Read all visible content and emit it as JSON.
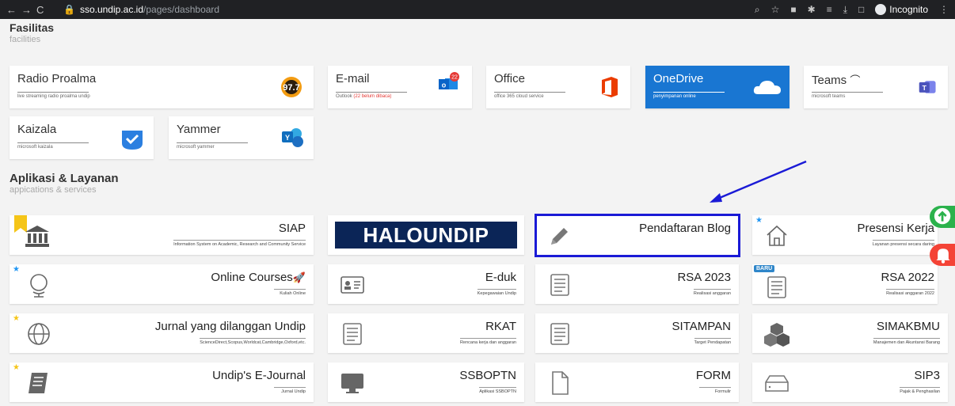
{
  "browser": {
    "url_host": "sso.undip.ac.id",
    "url_path": "/pages/dashboard",
    "incognito_label": "Incognito"
  },
  "facilities": {
    "title": "Fasilitas",
    "subtitle": "facilities",
    "items": [
      {
        "title": "Radio Proalma",
        "sub": "live streaming radio proalma undip",
        "icon": "radio-97-7-icon"
      },
      {
        "title": "E-mail",
        "sub": "Outlook",
        "sub_extra": "(22 belum dibaca)",
        "badge": "22",
        "icon": "outlook-icon"
      },
      {
        "title": "Office",
        "sub": "office 365 cloud service",
        "icon": "office-icon"
      },
      {
        "title": "OneDrive",
        "sub": "penyimpanan online",
        "icon": "onedrive-icon"
      },
      {
        "title": "Teams",
        "sub": "microsoft teams",
        "icon": "teams-icon"
      },
      {
        "title": "Kaizala",
        "sub": "microsoft kaizala",
        "icon": "kaizala-icon"
      },
      {
        "title": "Yammer",
        "sub": "microsoft yammer",
        "icon": "yammer-icon"
      }
    ]
  },
  "apps": {
    "title": "Aplikasi & Layanan",
    "subtitle": "appications & services",
    "items": [
      {
        "title": "SIAP",
        "sub": "Information System on Academic, Research and Community Service",
        "icon": "building-icon"
      },
      {
        "title": "HALOUNDIP",
        "sub": "",
        "icon": "haloundip-logo"
      },
      {
        "title": "Pendaftaran Blog",
        "sub": "",
        "icon": "pencil-icon"
      },
      {
        "title": "Presensi Kerja",
        "sub": "Layanan presensi secara daring",
        "icon": "home-icon"
      },
      {
        "title": "Online Courses",
        "sub": "Kuliah Online",
        "icon": "globe-stand-icon"
      },
      {
        "title": "E-duk",
        "sub": "Kepegawaian Undip",
        "icon": "id-card-icon"
      },
      {
        "title": "RSA 2023",
        "sub": "Realisasi anggaran",
        "icon": "newspaper-icon"
      },
      {
        "title": "RSA 2022",
        "sub": "Realisasi anggaran 2022",
        "icon": "newspaper-icon",
        "badge": "BARU"
      },
      {
        "title": "Jurnal yang dilanggan Undip",
        "sub": "ScienceDirect,Scopus,Worldcat,Cambridge,Oxford,etc.",
        "icon": "globe-icon"
      },
      {
        "title": "RKAT",
        "sub": "Rencana kerja dan anggaran",
        "icon": "newspaper-icon"
      },
      {
        "title": "SITAMPAN",
        "sub": "Target Pendapatan",
        "icon": "newspaper-icon"
      },
      {
        "title": "SIMAKBMU",
        "sub": "Manajemen dan Akuntansi Barang",
        "icon": "cubes-icon"
      },
      {
        "title": "Undip's E-Journal",
        "sub": "Jurnal Undip",
        "icon": "book-icon"
      },
      {
        "title": "SSBOPTN",
        "sub": "Aplikasi SSBOPTN",
        "icon": "monitor-icon"
      },
      {
        "title": "FORM",
        "sub": "Formulir",
        "icon": "file-icon"
      },
      {
        "title": "SIP3",
        "sub": "Pajak & Penghasilan",
        "icon": "drive-icon"
      }
    ]
  },
  "colors": {
    "accent_blue": "#1976d2",
    "highlight_box": "#1a1ad6",
    "star_blue": "#2196f3",
    "star_gold": "#f5c518",
    "upload_green": "#2bb24c",
    "bell_red": "#f44336"
  }
}
